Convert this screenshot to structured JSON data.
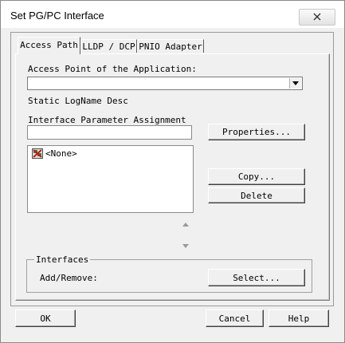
{
  "window": {
    "title": "Set PG/PC Interface"
  },
  "tabs": [
    {
      "label": "Access Path",
      "active": true
    },
    {
      "label": "LLDP / DCP",
      "active": false
    },
    {
      "label": "PNIO Adapter",
      "active": false
    }
  ],
  "access_path": {
    "access_point_label": "Access Point of the Application:",
    "access_point_value": "",
    "static_logname": "Static LogName Desc",
    "interface_param_label": "Interface Parameter Assignment",
    "interface_param_value": "",
    "properties_button": "Properties...",
    "list_items": [
      {
        "label": "<None>",
        "icon": "network-adapter-icon"
      }
    ],
    "copy_button": "Copy...",
    "delete_button": "Delete",
    "interfaces_group_label": "Interfaces",
    "add_remove_label": "Add/Remove:",
    "select_button": "Select..."
  },
  "footer": {
    "ok_button": "OK",
    "cancel_button": "Cancel",
    "help_button": "Help"
  }
}
